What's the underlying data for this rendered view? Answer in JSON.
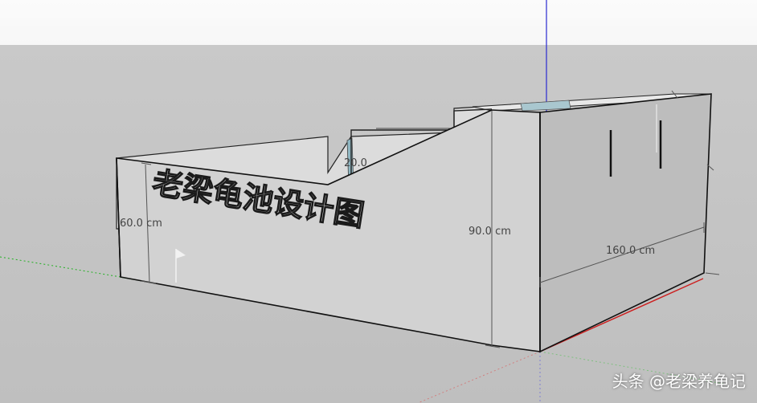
{
  "model": {
    "engraved_text": "老梁龟池设计图",
    "dimensions": {
      "left_height": "60.0 cm",
      "right_height": "90.0 cm",
      "depth": "160.0 cm",
      "partial": "20.0"
    }
  },
  "watermark": "头条 @老梁养龟记",
  "colors": {
    "sky": "#f7f7f7",
    "ground": "#c4c4c4",
    "wall_front": "#d2d2d2",
    "wall_side": "#bdbdbd",
    "wall_inner": "#e4e4e4",
    "glass": "#a9c7cf",
    "axis_green": "#22b022",
    "axis_red": "#cc2020",
    "axis_blue": "#2a2ad0"
  }
}
